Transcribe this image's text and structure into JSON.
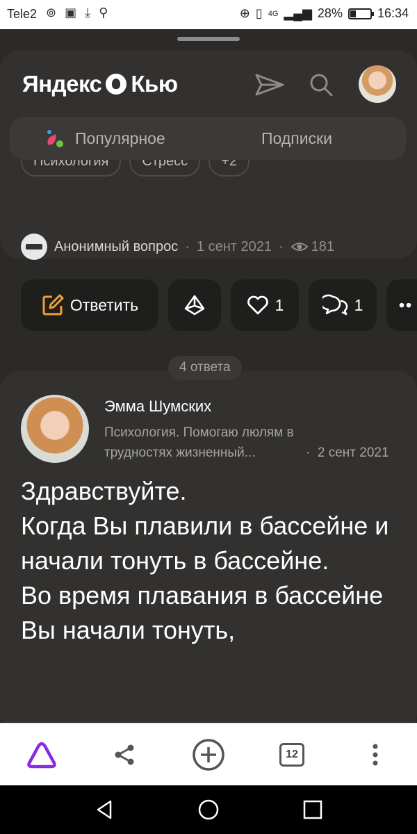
{
  "status_bar": {
    "carrier": "Tele2",
    "network": "4G",
    "battery_text": "28%",
    "battery_level": 0.28,
    "time": "16:34"
  },
  "header": {
    "logo_left": "Яндекс",
    "logo_right": "Кью",
    "tabs": [
      {
        "label": "Популярное",
        "active": true
      },
      {
        "label": "Подписки",
        "active": false
      }
    ]
  },
  "question": {
    "tags": [
      "Психология",
      "Стресс",
      "+2"
    ],
    "author": "Анонимный вопрос",
    "date": "1 сент 2021",
    "views": "181"
  },
  "actions": {
    "answer_label": "Ответить",
    "likes": "1",
    "comments": "1"
  },
  "answers_count": "4 ответа",
  "answer": {
    "author_name": "Эмма Шумских",
    "author_desc": "Психология. Помогаю люлям в трудностях жизненный...",
    "date": "2 сент 2021",
    "text": "Здравствуйте.\nКогда Вы плавили в бассейне и начали тонуть в бассейне.\nВо время плавания в бассейне Вы начали тонуть,"
  },
  "toolbar": {
    "tabs_count": "12"
  },
  "colors": {
    "accent_orange": "#f0a030",
    "alice_purple": "#8a2be2",
    "card_bg": "#323130"
  }
}
